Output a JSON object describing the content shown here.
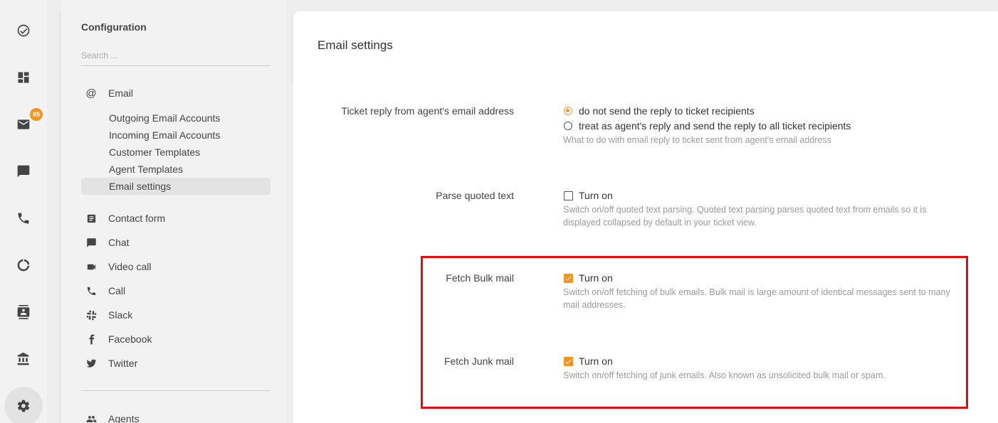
{
  "rail": {
    "items": [
      {
        "icon": "check-circle-icon"
      },
      {
        "icon": "dashboard-icon"
      },
      {
        "icon": "mail-icon",
        "badge": "85"
      },
      {
        "icon": "chat-icon"
      },
      {
        "icon": "phone-icon"
      },
      {
        "icon": "reports-icon"
      },
      {
        "icon": "contacts-icon"
      },
      {
        "icon": "companies-icon"
      },
      {
        "icon": "settings-icon"
      }
    ]
  },
  "sidebar": {
    "title": "Configuration",
    "search_placeholder": "Search ...",
    "email_label": "Email",
    "email_subitems": [
      "Outgoing Email Accounts",
      "Incoming Email Accounts",
      "Customer Templates",
      "Agent Templates",
      "Email settings"
    ],
    "sections": [
      "Contact form",
      "Chat",
      "Video call",
      "Call",
      "Slack",
      "Facebook",
      "Twitter"
    ],
    "agents_label": "Agents"
  },
  "main": {
    "title": "Email settings",
    "ticket_reply": {
      "label": "Ticket reply from agent's email address",
      "option1": "do not send the reply to ticket recipients",
      "option2": "treat as agent's reply and send the reply to all ticket recipients",
      "help": "What to do with email reply to ticket sent from agent's email address"
    },
    "parse_quoted": {
      "label": "Parse quoted text",
      "toggle": "Turn on",
      "help": "Switch on/off quoted text parsing. Quoted text parsing parses quoted text from emails so it is displayed collapsed by default in your ticket view."
    },
    "fetch_bulk": {
      "label": "Fetch Bulk mail",
      "toggle": "Turn on",
      "help": "Switch on/off fetching of bulk emails. Bulk mail is large amount of identical messages sent to many mail addresses."
    },
    "fetch_junk": {
      "label": "Fetch Junk mail",
      "toggle": "Turn on",
      "help": "Switch on/off fetching of junk emails. Also known as unsolicited bulk mail or spam."
    }
  },
  "colors": {
    "accent": "#f39423",
    "highlight": "#e30b0b"
  }
}
